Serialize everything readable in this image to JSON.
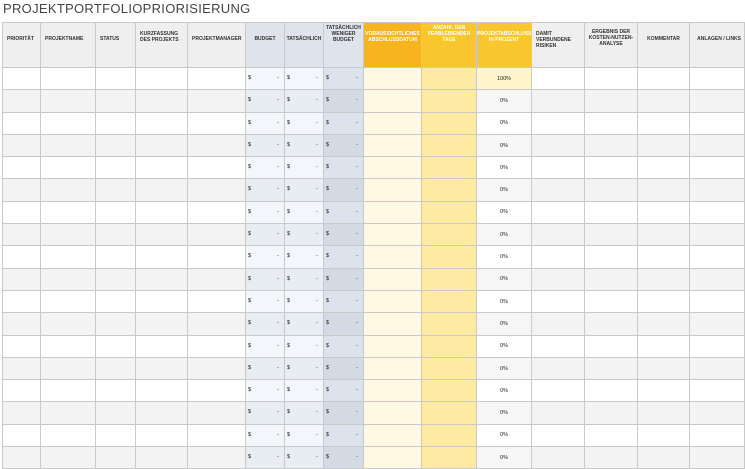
{
  "title": "PROJEKTPORTFOLIOPRIORISIERUNG",
  "columns": [
    "PRIORITÄT",
    "PROJEKTNAME",
    "STATUS",
    "KURZFASSUNG DES PROJEKTS",
    "PROJEKTMANAGER",
    "BUDGET",
    "TATSÄCHLICH",
    "TATSÄCHLICH WENIGER BUDGET",
    "VORAUSSICHTLICHES ABSCHLUSSDATUM",
    "ANZAHL DER VERBLEIBENDEN TAGE",
    "PROJEKTABSCHLUSS IN PROZENT",
    "DAMIT VERBUNDENE RISIKEN",
    "ERGEBNIS DER KOSTEN-NUTZEN-ANALYSE",
    "KOMMENTAR",
    "ANLAGEN / LINKS"
  ],
  "currency_symbol": "$",
  "empty_value": "-",
  "completion_percent": [
    "100%",
    "0%",
    "0%",
    "0%",
    "0%",
    "0%",
    "0%",
    "0%",
    "0%",
    "0%",
    "0%",
    "0%",
    "0%",
    "0%",
    "0%",
    "0%",
    "0%",
    "0%"
  ],
  "colors": {
    "header_gray": "#efefef",
    "header_blue": "#dfe4ec",
    "header_orange": "#f6b520",
    "header_yellow": "#f8c62f",
    "date_fill": "#fff8e3",
    "days_fill": "#feeaa2"
  }
}
